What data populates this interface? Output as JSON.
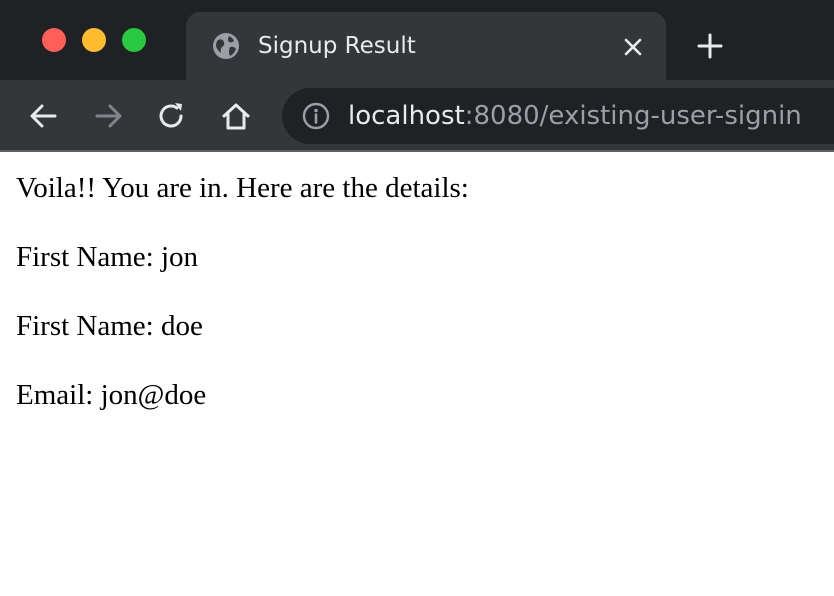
{
  "window": {
    "traffic_lights": {
      "close_color": "#ff5f57",
      "minimize_color": "#febc2e",
      "maximize_color": "#28c840"
    }
  },
  "tab": {
    "title": "Signup Result",
    "icon": "globe-icon",
    "close_icon": "close-icon"
  },
  "new_tab_icon": "plus-icon",
  "toolbar": {
    "back_icon": "arrow-left-icon",
    "forward_icon": "arrow-right-icon",
    "reload_icon": "reload-icon",
    "home_icon": "home-icon"
  },
  "address_bar": {
    "info_icon": "info-icon",
    "host": "localhost",
    "path": ":8080/existing-user-signin"
  },
  "page": {
    "greeting": "Voila!! You are in. Here are the details:",
    "first_name_line": "First Name: jon",
    "last_name_line": "First Name: doe",
    "email_line": "Email: jon@doe"
  },
  "colors": {
    "tabstrip_bg": "#202124",
    "toolbar_bg": "#35363a",
    "text_light": "#e8eaed",
    "text_muted": "#9aa0a6"
  }
}
